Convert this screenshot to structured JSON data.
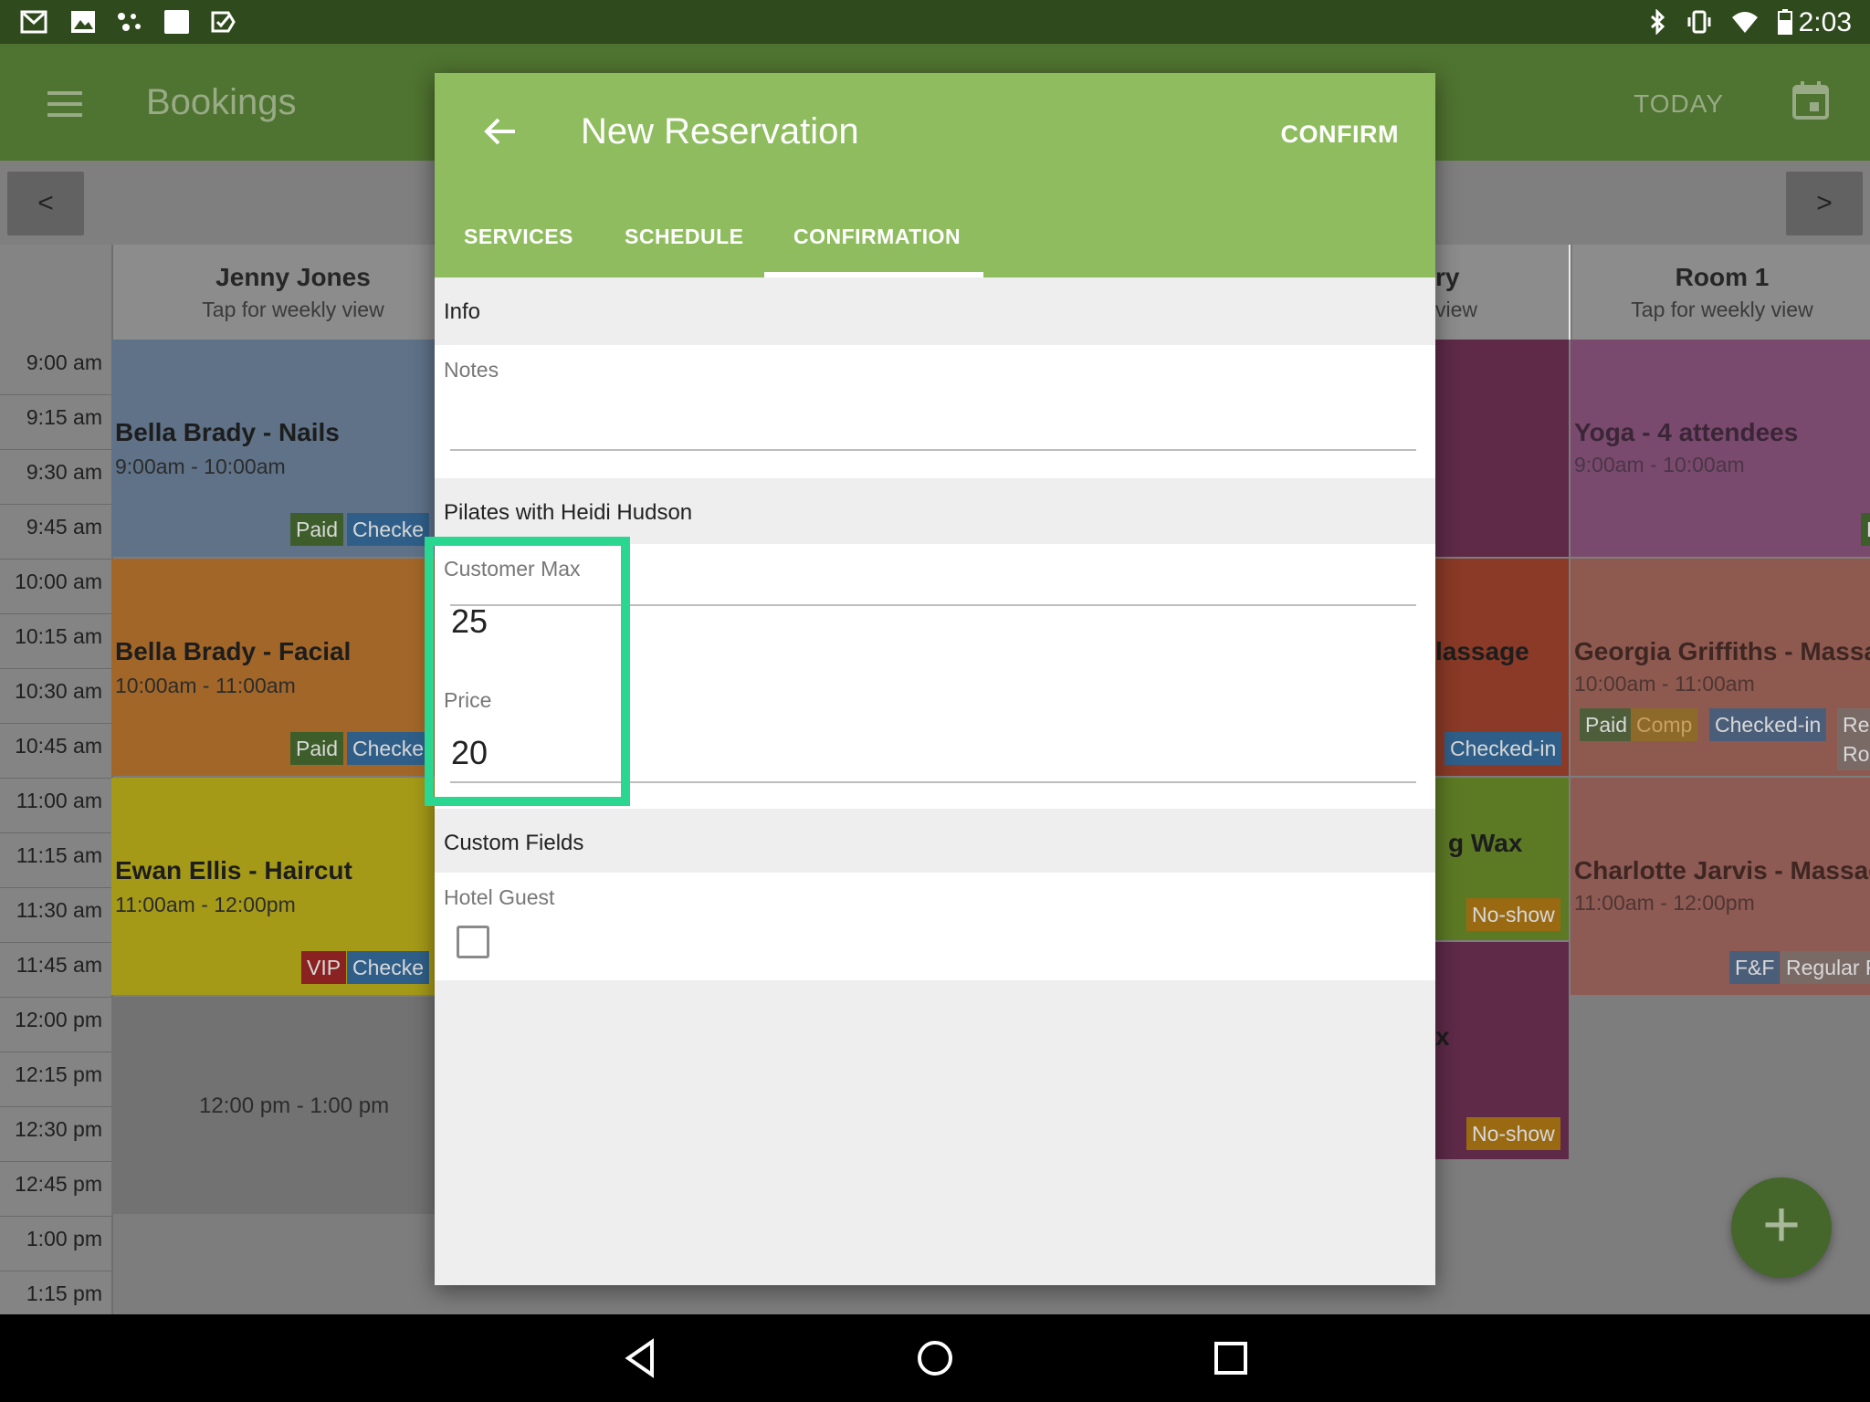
{
  "status_bar": {
    "time": "2:03"
  },
  "app_bar": {
    "title": "Bookings",
    "today_label": "TODAY"
  },
  "nav": {
    "prev_label": "<",
    "next_label": ">"
  },
  "columns": [
    {
      "name": "Jenny Jones",
      "subtitle": "Tap for weekly view"
    },
    {
      "name": "ry",
      "subtitle": "view"
    },
    {
      "name": "Room 1",
      "subtitle": "Tap for weekly view"
    }
  ],
  "times": [
    "9:00 am",
    "9:15 am",
    "9:30 am",
    "9:45 am",
    "10:00 am",
    "10:15 am",
    "10:30 am",
    "10:45 am",
    "11:00 am",
    "11:15 am",
    "11:30 am",
    "11:45 am",
    "12:00 pm",
    "12:15 pm",
    "12:30 pm",
    "12:45 pm",
    "1:00 pm",
    "1:15 pm"
  ],
  "events": {
    "jenny": [
      {
        "title": "Bella Brady - Nails",
        "time": "9:00am - 10:00am",
        "tags": [
          "Paid",
          "Checke"
        ]
      },
      {
        "title": "Bella Brady - Facial",
        "time": "10:00am - 11:00am",
        "tags": [
          "Paid",
          "Checke"
        ]
      },
      {
        "title": "Ewan Ellis - Haircut",
        "time": "11:00am - 12:00pm",
        "tags": [
          "VIP",
          "Checke"
        ]
      },
      {
        "title": "12:00 pm - 1:00 pm"
      }
    ],
    "middle": [
      {
        "title": "lassage",
        "tags": [
          "Checked-in"
        ]
      },
      {
        "title": "g Wax",
        "tags": [
          "No-show"
        ]
      },
      {
        "title": "x",
        "tags": [
          "No-show"
        ]
      }
    ],
    "room": [
      {
        "title": "Yoga - 4 attendees",
        "time": "9:00am - 10:00am",
        "tags": [
          "P"
        ]
      },
      {
        "title": "Georgia Griffiths - Massag",
        "time": "10:00am - 11:00am",
        "tags": [
          "Paid",
          "Comp",
          "Checked-in",
          "Reg",
          "Roo"
        ]
      },
      {
        "title": "Charlotte Jarvis - Massag",
        "time": "11:00am - 12:00pm",
        "tags": [
          "F&F",
          "Regular R"
        ]
      }
    ]
  },
  "modal": {
    "title": "New Reservation",
    "confirm_label": "CONFIRM",
    "tabs": [
      "SERVICES",
      "SCHEDULE",
      "CONFIRMATION"
    ],
    "info_section": "Info",
    "notes_label": "Notes",
    "notes_value": "",
    "service_section": "Pilates with Heidi Hudson",
    "customer_max_label": "Customer Max",
    "customer_max_value": "25",
    "price_label": "Price",
    "price_value": "20",
    "custom_fields_section": "Custom Fields",
    "hotel_guest_label": "Hotel Guest",
    "hotel_guest_checked": false
  },
  "fab_symbol": "+",
  "colors": {
    "modal_header": "#8fbc5f",
    "app_bar": "#4f7330",
    "highlight": "#2bd690"
  },
  "icons": [
    "gmail-icon",
    "photos-icon",
    "dots-icon",
    "square-icon",
    "check-icon",
    "bluetooth-icon",
    "vibrate-icon",
    "wifi-icon",
    "battery-icon",
    "menu-icon",
    "calendar-icon",
    "back-arrow-icon",
    "back-nav-icon",
    "home-nav-icon",
    "recents-nav-icon"
  ]
}
